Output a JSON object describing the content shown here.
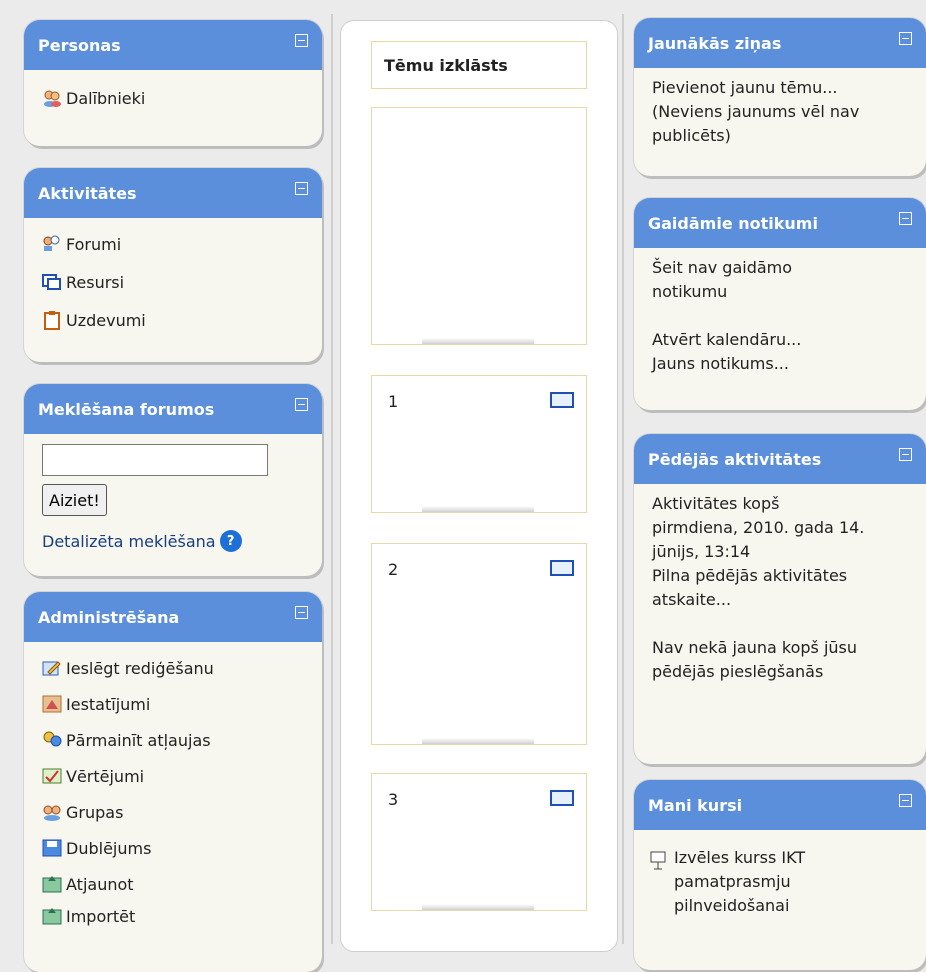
{
  "left": {
    "personas": {
      "title": "Personas",
      "items": [
        {
          "label": "Dalībnieki",
          "icon": "participants-icon"
        }
      ]
    },
    "aktivitates": {
      "title": "Aktivitātes",
      "items": [
        {
          "label": "Forumi",
          "icon": "forum-icon"
        },
        {
          "label": "Resursi",
          "icon": "resource-icon"
        },
        {
          "label": "Uzdevumi",
          "icon": "assignment-icon"
        }
      ]
    },
    "search": {
      "title": "Meklēšana forumos",
      "placeholder": "",
      "button": "Aiziet!",
      "advanced": "Detalizēta meklēšana"
    },
    "admin": {
      "title": "Administrēšana",
      "items": [
        {
          "label": "Ieslēgt rediģēšanu",
          "icon": "edit-icon"
        },
        {
          "label": "Iestatījumi",
          "icon": "settings-icon"
        },
        {
          "label": "Pārmainīt atļaujas",
          "icon": "permissions-icon"
        },
        {
          "label": "Vērtējumi",
          "icon": "grades-icon"
        },
        {
          "label": "Grupas",
          "icon": "groups-icon"
        },
        {
          "label": "Dublējums",
          "icon": "backup-icon"
        },
        {
          "label": "Atjaunot",
          "icon": "restore-icon"
        },
        {
          "label": "Importēt",
          "icon": "import-icon"
        }
      ]
    }
  },
  "middle": {
    "title": "Tēmu izklāsts",
    "sections": [
      "1",
      "2",
      "3"
    ]
  },
  "right": {
    "news": {
      "title": "Jaunākās ziņas",
      "lines": [
        "Pievienot jaunu tēmu...",
        "(Neviens jaunums vēl nav",
        "publicēts)"
      ]
    },
    "events": {
      "title": "Gaidāmie notikumi",
      "lines": [
        "Šeit nav gaidāmo",
        "notikumu"
      ],
      "calendar": "Atvērt kalendāru...",
      "newevent": "Jauns notikums..."
    },
    "recent": {
      "title": "Pēdējās aktivitātes",
      "lines": [
        "Aktivitātes kopš",
        "pirmdiena, 2010. gada 14.",
        "jūnijs, 13:14"
      ],
      "report": [
        "Pilna pēdējās aktivitātes",
        "atskaite..."
      ],
      "nothing": [
        "Nav nekā jauna kopš jūsu",
        "pēdējās pieslēgšanās"
      ]
    },
    "courses": {
      "title": "Mani kursi",
      "lines": [
        "Izvēles kurss IKT",
        "pamatprasmju",
        "pilnveidošanai"
      ]
    }
  }
}
